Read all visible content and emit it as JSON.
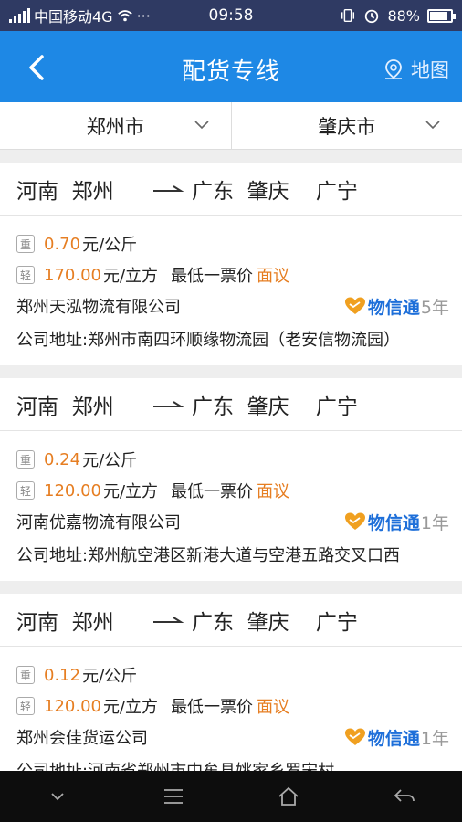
{
  "status_bar": {
    "carrier": "中国移动4G",
    "dots": "···",
    "time": "09:58",
    "battery": "88%",
    "battery_level": 0.88
  },
  "header": {
    "title": "配货专线",
    "map_label": "地图"
  },
  "filters": {
    "origin": "郑州市",
    "destination": "肇庆市"
  },
  "listings": [
    {
      "from": "河南  郑州",
      "to": "广东  肇庆    广宁",
      "weight_price": "0.70",
      "weight_unit": "元/公斤",
      "volume_price": "170.00",
      "volume_unit": "元/立方",
      "min_label": "最低一票价",
      "min_value": "面议",
      "company": "郑州天泓物流有限公司",
      "badge_brand": "物信通",
      "badge_years": "5年",
      "address": "公司地址:郑州市南四环顺缘物流园（老安信物流园）"
    },
    {
      "from": "河南  郑州",
      "to": "广东  肇庆    广宁",
      "weight_price": "0.24",
      "weight_unit": "元/公斤",
      "volume_price": "120.00",
      "volume_unit": "元/立方",
      "min_label": "最低一票价",
      "min_value": "面议",
      "company": "河南优嘉物流有限公司",
      "badge_brand": "物信通",
      "badge_years": "1年",
      "address": "公司地址:郑州航空港区新港大道与空港五路交叉口西"
    },
    {
      "from": "河南  郑州",
      "to": "广东  肇庆    广宁",
      "weight_price": "0.12",
      "weight_unit": "元/公斤",
      "volume_price": "120.00",
      "volume_unit": "元/立方",
      "min_label": "最低一票价",
      "min_value": "面议",
      "company": "郑州会佳货运公司",
      "badge_brand": "物信通",
      "badge_years": "1年",
      "address": "公司地址:河南省郑州市中牟县姚家乡罗宋村"
    }
  ],
  "icons": {
    "weight_tag": "重",
    "volume_tag": "轻"
  },
  "colors": {
    "header": "#1e88e5",
    "price": "#e67e22",
    "brand": "#1e6fd9",
    "badge_heart": "#f0a020"
  }
}
